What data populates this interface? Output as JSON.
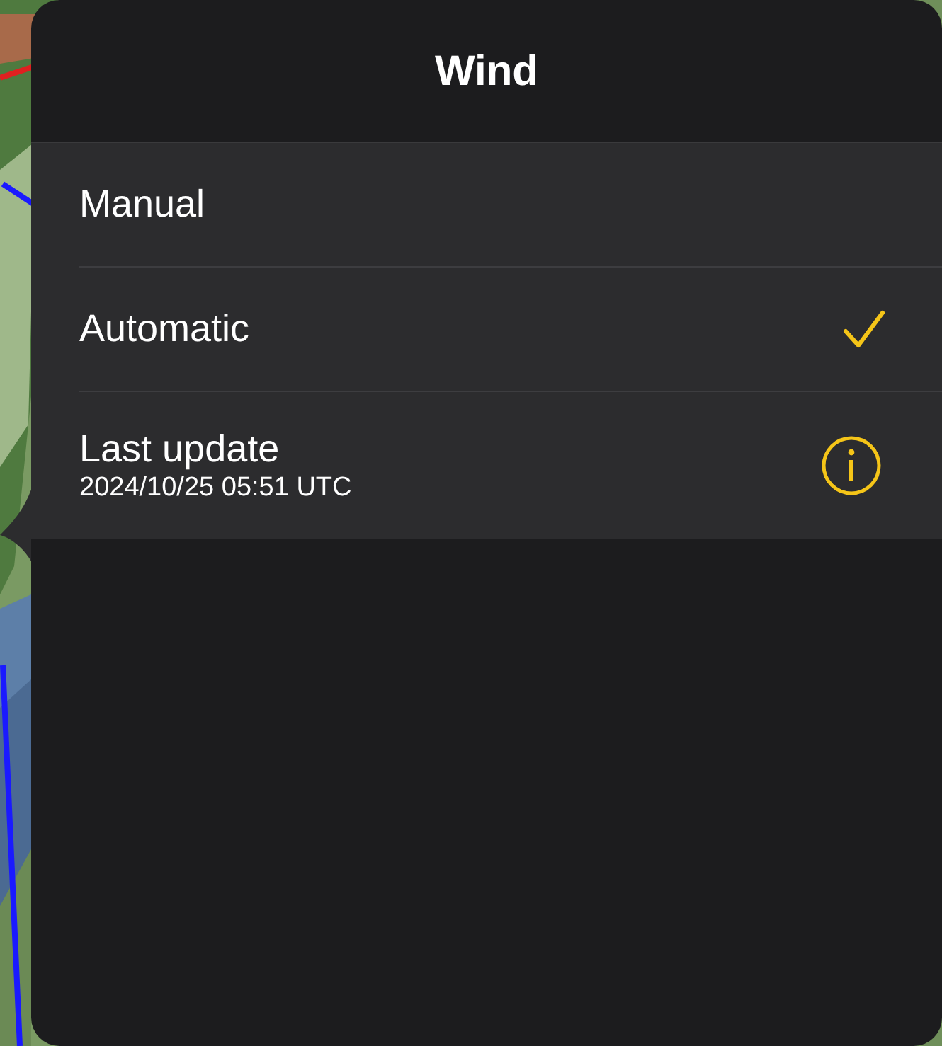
{
  "title": "Wind",
  "options": [
    {
      "label": "Manual",
      "selected": false
    },
    {
      "label": "Automatic",
      "selected": true
    }
  ],
  "last_update": {
    "label": "Last update",
    "value": "2024/10/25 05:51 UTC"
  }
}
